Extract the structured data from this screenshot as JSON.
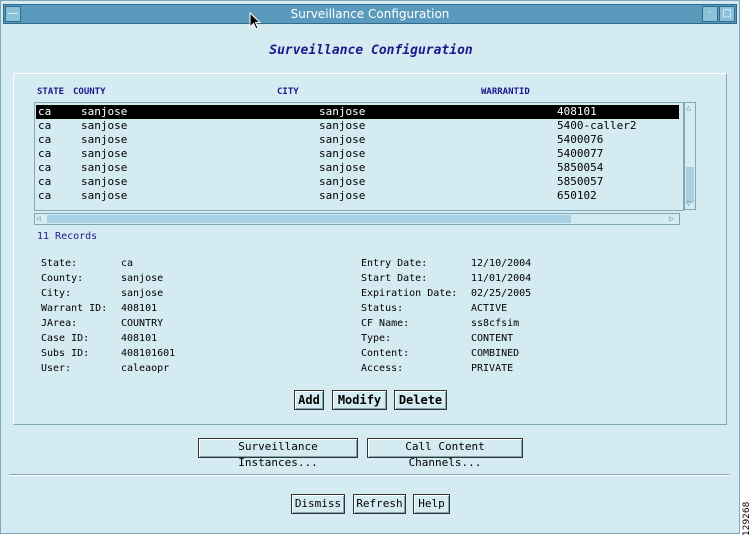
{
  "window": {
    "title": "Surveillance Configuration",
    "menu_icon": "minus-icon",
    "min_icon": "dot-icon",
    "max_icon": "square-icon"
  },
  "dialog_title": "Surveillance Configuration",
  "table": {
    "columns": [
      "STATE",
      "COUNTY",
      "CITY",
      "WARRANTID"
    ],
    "rows": [
      {
        "state": "ca",
        "county": "sanjose",
        "city": "sanjose",
        "warrant": "408101",
        "selected": true
      },
      {
        "state": "ca",
        "county": "sanjose",
        "city": "sanjose",
        "warrant": "5400-caller2"
      },
      {
        "state": "ca",
        "county": "sanjose",
        "city": "sanjose",
        "warrant": "5400076"
      },
      {
        "state": "ca",
        "county": "sanjose",
        "city": "sanjose",
        "warrant": "5400077"
      },
      {
        "state": "ca",
        "county": "sanjose",
        "city": "sanjose",
        "warrant": "5850054"
      },
      {
        "state": "ca",
        "county": "sanjose",
        "city": "sanjose",
        "warrant": "5850057"
      },
      {
        "state": "ca",
        "county": "sanjose",
        "city": "sanjose",
        "warrant": "650102"
      }
    ],
    "records": "11 Records"
  },
  "details": {
    "left": [
      {
        "label": "State:",
        "value": "ca"
      },
      {
        "label": "County:",
        "value": "sanjose"
      },
      {
        "label": "City:",
        "value": "sanjose"
      },
      {
        "label": "Warrant ID:",
        "value": "408101"
      },
      {
        "label": "JArea:",
        "value": "COUNTRY"
      },
      {
        "label": "Case ID:",
        "value": "408101"
      },
      {
        "label": "Subs ID:",
        "value": "408101601"
      },
      {
        "label": "User:",
        "value": "caleaopr"
      }
    ],
    "right": [
      {
        "label": "Entry Date:",
        "value": "12/10/2004"
      },
      {
        "label": "Start Date:",
        "value": "11/01/2004"
      },
      {
        "label": "Expiration Date:",
        "value": "02/25/2005"
      },
      {
        "label": "Status:",
        "value": "ACTIVE"
      },
      {
        "label": "CF Name:",
        "value": "ss8cfsim"
      },
      {
        "label": "Type:",
        "value": "CONTENT"
      },
      {
        "label": "Content:",
        "value": "COMBINED"
      },
      {
        "label": "Access:",
        "value": "PRIVATE"
      }
    ]
  },
  "buttons": {
    "add": "Add",
    "modify": "Modify",
    "delete": "Delete",
    "instances": "Surveillance Instances...",
    "channels": "Call Content Channels...",
    "dismiss": "Dismiss",
    "refresh": "Refresh",
    "help": "Help"
  },
  "image_number": "129268",
  "colors": {
    "background": "#d5ebf2",
    "titlebar": "#5a9bbd",
    "heading": "#1a1a8c",
    "selection": "#000000"
  }
}
